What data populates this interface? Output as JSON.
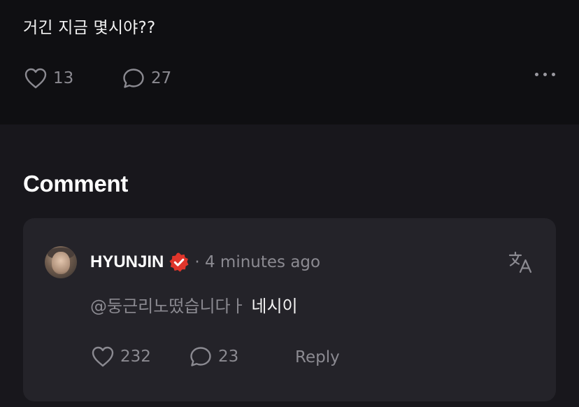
{
  "post": {
    "text": "거긴 지금 몇시야??",
    "likes": "13",
    "comments": "27"
  },
  "section_title": "Comment",
  "comment": {
    "author": "HYUNJIN",
    "meta": "· 4 minutes ago",
    "mention": "@둥근리노떴습니다ㅏ",
    "text": " 네시이",
    "likes": "232",
    "replies": "23",
    "reply_label": "Reply"
  },
  "colors": {
    "background": "#18171c",
    "post_background": "#0f0f12",
    "card_background": "#242329",
    "muted_text": "#8b8a91",
    "verified_badge": "#e0352b"
  },
  "icons": [
    "heart-icon",
    "comment-icon",
    "more-icon",
    "verified-icon",
    "translate-icon"
  ]
}
